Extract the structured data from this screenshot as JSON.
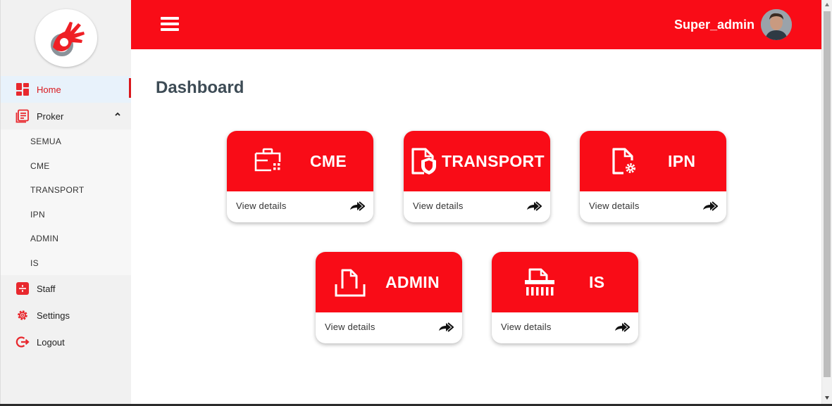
{
  "header": {
    "user_name": "Super_admin"
  },
  "sidebar": {
    "items": [
      {
        "label": "Home"
      },
      {
        "label": "Proker"
      },
      {
        "label": "Staff"
      },
      {
        "label": "Settings"
      },
      {
        "label": "Logout"
      }
    ],
    "proker_sub": [
      "SEMUA",
      "CME",
      "TRANSPORT",
      "IPN",
      "ADMIN",
      "IS"
    ]
  },
  "main": {
    "title": "Dashboard",
    "cards": [
      {
        "label": "CME",
        "icon": "briefcase-icon",
        "link": "View details"
      },
      {
        "label": "TRANSPORT",
        "icon": "shield-file-icon",
        "link": "View details"
      },
      {
        "label": "IPN",
        "icon": "file-gear-icon",
        "link": "View details"
      },
      {
        "label": "ADMIN",
        "icon": "file-tray-icon",
        "link": "View details"
      },
      {
        "label": "IS",
        "icon": "shredder-icon",
        "link": "View details"
      }
    ]
  },
  "colors": {
    "brand_red": "#f90c17",
    "active_red": "#d9181e",
    "title": "#3d4b55"
  }
}
